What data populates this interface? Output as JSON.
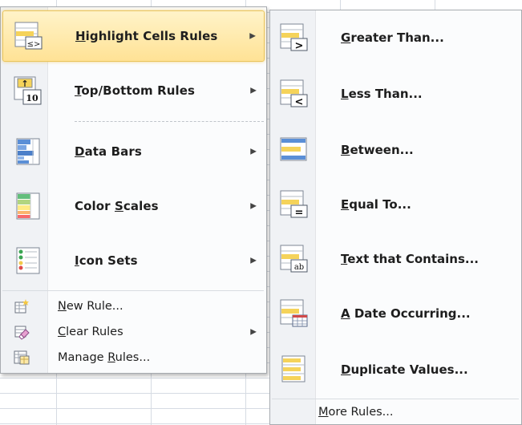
{
  "main_menu": {
    "items": [
      {
        "pre": "",
        "key": "H",
        "post": "ighlight Cells Rules",
        "icon": "highlight-cells-rules-icon",
        "submenu": true
      },
      {
        "pre": "",
        "key": "T",
        "post": "op/Bottom Rules",
        "icon": "top-bottom-rules-icon",
        "submenu": true
      },
      {
        "pre": "",
        "key": "D",
        "post": "ata Bars",
        "icon": "data-bars-icon",
        "submenu": true
      },
      {
        "pre": "Color ",
        "key": "S",
        "post": "cales",
        "icon": "color-scales-icon",
        "submenu": true
      },
      {
        "pre": "",
        "key": "I",
        "post": "con Sets",
        "icon": "icon-sets-icon",
        "submenu": true
      }
    ],
    "small_items": [
      {
        "pre": "",
        "key": "N",
        "post": "ew Rule...",
        "icon": "new-rule-icon",
        "submenu": false
      },
      {
        "pre": "",
        "key": "C",
        "post": "lear Rules",
        "icon": "clear-rules-icon",
        "submenu": true
      },
      {
        "pre": "Manage ",
        "key": "R",
        "post": "ules...",
        "icon": "manage-rules-icon",
        "submenu": false
      }
    ],
    "arrow": "▶"
  },
  "submenu": {
    "items": [
      {
        "pre": "",
        "key": "G",
        "post": "reater Than...",
        "icon": "greater-than-icon"
      },
      {
        "pre": "",
        "key": "L",
        "post": "ess Than...",
        "icon": "less-than-icon"
      },
      {
        "pre": "",
        "key": "B",
        "post": "etween...",
        "icon": "between-icon"
      },
      {
        "pre": "",
        "key": "E",
        "post": "qual To...",
        "icon": "equal-to-icon"
      },
      {
        "pre": "",
        "key": "T",
        "post": "ext that Contains...",
        "icon": "text-contains-icon"
      },
      {
        "pre": "",
        "key": "A",
        "post": " Date Occurring...",
        "icon": "date-occurring-icon"
      },
      {
        "pre": "",
        "key": "D",
        "post": "uplicate Values...",
        "icon": "duplicate-values-icon"
      }
    ],
    "more": {
      "pre": "",
      "key": "M",
      "post": "ore Rules..."
    }
  },
  "icon_text": {
    "greater": ">",
    "less": "<",
    "equal": "=",
    "ab": "ab",
    "ten": "10",
    "up": "↑",
    "lte": "≤>"
  },
  "colors": {
    "highlight_top": "#fff3c9",
    "highlight_bottom": "#ffe295",
    "highlight_border": "#e9c45b",
    "bar_yellow": "#f5d35a",
    "bar_blue": "#5b8fd6"
  }
}
